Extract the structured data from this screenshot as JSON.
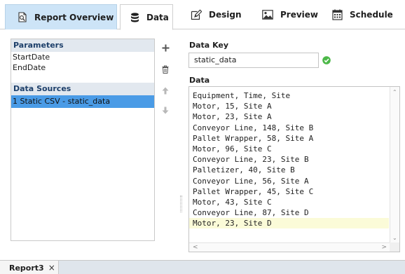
{
  "tabs": [
    {
      "label": "Report Overview",
      "icon": "report-overview-icon"
    },
    {
      "label": "Data",
      "icon": "database-icon"
    },
    {
      "label": "Design",
      "icon": "design-icon"
    },
    {
      "label": "Preview",
      "icon": "preview-icon"
    },
    {
      "label": "Schedule",
      "icon": "calendar-icon"
    }
  ],
  "active_tab": "Data",
  "left_panel": {
    "parameters_header": "Parameters",
    "parameters": [
      "StartDate",
      "EndDate"
    ],
    "data_sources_header": "Data Sources",
    "data_sources": [
      "1 Static CSV - static_data"
    ]
  },
  "tools": [
    "add-icon",
    "delete-icon",
    "move-up-icon",
    "move-down-icon"
  ],
  "editor": {
    "data_key_label": "Data Key",
    "data_key_value": "static_data",
    "data_label": "Data",
    "lines": [
      "Equipment, Time, Site",
      "Motor, 15, Site A",
      "Motor, 23, Site A",
      "Conveyor Line, 148, Site B",
      "Pallet Wrapper, 58, Site A",
      "Motor, 96, Site C",
      "Conveyor Line, 23, Site B",
      "Palletizer, 40, Site B",
      "Conveyor Line, 56, Site A",
      "Pallet Wrapper, 45, Site C",
      "Motor, 43, Site C",
      "Conveyor Line, 87, Site D",
      "Motor, 23, Site D"
    ]
  },
  "document_tab": {
    "label": "Report3",
    "close": "×"
  },
  "colors": {
    "active_tab_bg": "#cde4f7",
    "section_header_bg": "#e2e8ef",
    "selection_bg": "#4a9be6",
    "valid_green": "#4cb848",
    "current_line_bg": "#fbfbd8"
  }
}
